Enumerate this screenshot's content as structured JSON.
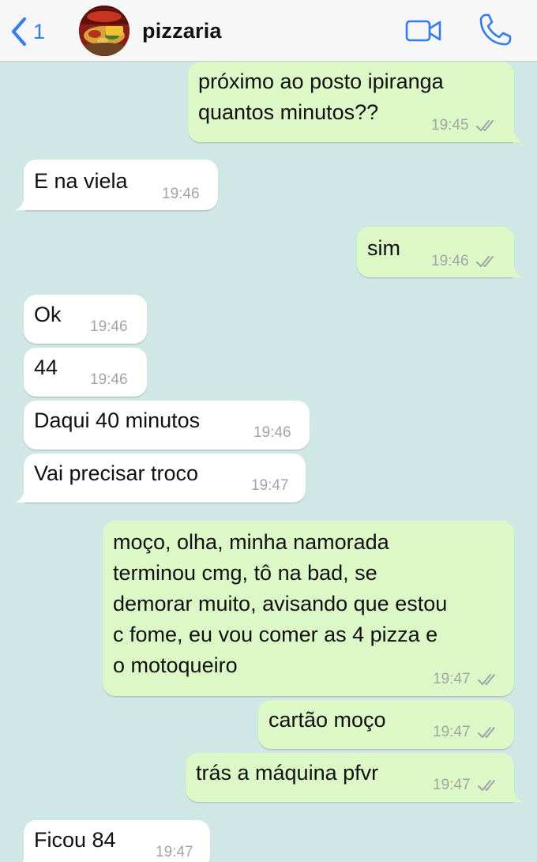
{
  "header": {
    "back_count": "1",
    "chat_title": "pizzaria",
    "avatar_label": "pizzaria avatar"
  },
  "colors": {
    "background": "#cfe7e5",
    "incoming_bubble": "#ffffff",
    "outgoing_bubble": "#dcf8c6",
    "accent": "#2f7cf6",
    "timestamp": "#a4a4a4",
    "read_ticks": "#9ea3a8"
  },
  "icons": {
    "back": "chevron-left-icon",
    "video": "video-camera-icon",
    "call": "phone-icon",
    "ticks": "double-check-icon"
  },
  "messages": [
    {
      "direction": "out",
      "lines": [
        "próximo ao posto ipiranga",
        "quantos minutos??"
      ],
      "time": "19:45",
      "read": true
    },
    {
      "direction": "in",
      "lines": [
        "E na viela"
      ],
      "time": "19:46"
    },
    {
      "direction": "out",
      "lines": [
        "sim"
      ],
      "time": "19:46",
      "read": true
    },
    {
      "direction": "in",
      "lines": [
        "Ok"
      ],
      "time": "19:46"
    },
    {
      "direction": "in",
      "lines": [
        "44"
      ],
      "time": "19:46"
    },
    {
      "direction": "in",
      "lines": [
        "Daqui 40 minutos"
      ],
      "time": "19:46"
    },
    {
      "direction": "in",
      "lines": [
        "Vai precisar troco"
      ],
      "time": "19:47"
    },
    {
      "direction": "out",
      "lines": [
        "moço, olha, minha namorada",
        "terminou cmg, tô na bad, se",
        "demorar muito, avisando que estou",
        "c fome, eu vou comer as 4 pizza e",
        "o motoqueiro"
      ],
      "time": "19:47",
      "read": true
    },
    {
      "direction": "out",
      "lines": [
        "cartão moço"
      ],
      "time": "19:47",
      "read": true
    },
    {
      "direction": "out",
      "lines": [
        "trás a máquina pfvr"
      ],
      "time": "19:47",
      "read": true
    },
    {
      "direction": "in",
      "lines": [
        "Ficou 84"
      ],
      "time": "19:47"
    }
  ]
}
